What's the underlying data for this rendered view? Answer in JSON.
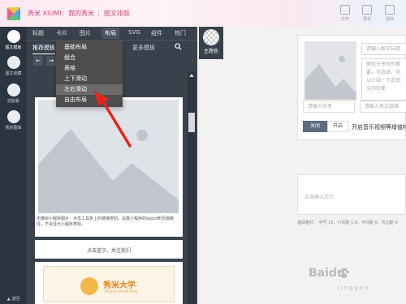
{
  "topbar": {
    "brand": "秀米 XIUMI",
    "nav": [
      "我的秀米",
      "图文排版"
    ],
    "nav_sep": "|",
    "buttons": [
      "打开",
      "预览",
      "保存"
    ]
  },
  "sidebar": {
    "items": [
      {
        "label": "图文模板",
        "icon": "template-icon",
        "active": true
      },
      {
        "label": "图文收藏",
        "icon": "favorites-icon",
        "active": false
      },
      {
        "label": "剪贴板",
        "icon": "clipboard-icon",
        "active": false
      },
      {
        "label": "我的图库",
        "icon": "gallery-icon",
        "active": false
      },
      {
        "label": "▲ 返回",
        "icon": "back-icon",
        "active": false
      }
    ]
  },
  "editor": {
    "tabs": [
      "标题",
      "卡片",
      "图片",
      "布局",
      "SVG",
      "组件",
      "热门"
    ],
    "active_tab": "布局",
    "subtabs": [
      "推荐模板",
      "更多模板"
    ],
    "search_icon": "search-icon",
    "theme_label": "主题色",
    "dropdown": {
      "items": [
        "基础布局",
        "组合",
        "表格",
        "上下滑动",
        "左右滑动",
        "自由布局"
      ],
      "highlighted": "左右滑动"
    },
    "preview": {
      "caption": "无曝标小程序图片：点击工具条上的链接按钮，设置小程序的appid和页面路径，不会显示小程序角标。",
      "banner": "点击蓝字，关注我们",
      "school_name": "秀米大学",
      "school_en": "Xiumi university"
    }
  },
  "canvas": {
    "title_input_placeholder": "请输入图文标题",
    "desc_placeholder": "微信分享时的封面摘要，可选填，不填时默认为正文前54字，仅支持纯文本",
    "desc_visible": "微信分享时的摘要，可选填，可以介绍一下此图文的封面",
    "author_placeholder": "请输入作者",
    "link_placeholder": "请输入原文链接",
    "music_toggle": {
      "off_label": "关闭",
      "on_label": "开启",
      "text": "开启音乐视频等增值特效",
      "state": "off"
    },
    "text_placeholder": "点击输入文字",
    "basic_format": "基础格式：  字号 16、行间距 1.6、字间距 0、页边距 0"
  },
  "watermark": {
    "text": "Baidu",
    "sub": "jingyan"
  },
  "colors": {
    "brand_pink": "#e0457b",
    "panel_dark": "#39424c",
    "sidebar_dark": "#2b3540",
    "arrow_red": "#e8231f",
    "accent_orange": "#e8861f"
  }
}
